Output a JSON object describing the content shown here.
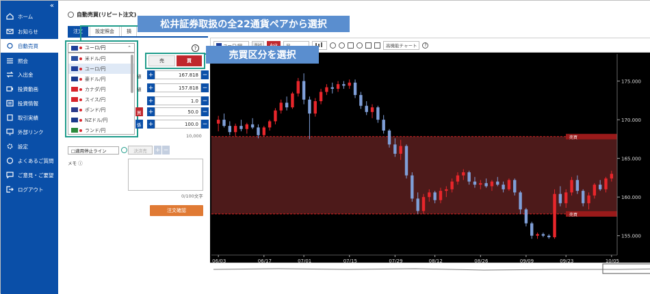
{
  "sidebar": {
    "collapse_icon": "«",
    "items": [
      {
        "label": "ホーム",
        "icon": "home-icon"
      },
      {
        "label": "お知らせ",
        "icon": "mail-icon"
      },
      {
        "label": "自動売買",
        "icon": "refresh-icon"
      },
      {
        "label": "照会",
        "icon": "list-icon"
      },
      {
        "label": "入出金",
        "icon": "transfer-icon"
      },
      {
        "label": "投資動画",
        "icon": "video-icon"
      },
      {
        "label": "投資情報",
        "icon": "news-icon"
      },
      {
        "label": "取引実績",
        "icon": "book-icon"
      },
      {
        "label": "外部リンク",
        "icon": "monitor-icon"
      },
      {
        "label": "設定",
        "icon": "gear-icon"
      },
      {
        "label": "よくあるご質問",
        "icon": "question-icon"
      },
      {
        "label": "ご意見・ご要望",
        "icon": "comment-icon"
      },
      {
        "label": "ログアウト",
        "icon": "logout-icon"
      }
    ]
  },
  "page": {
    "title": "自動売買(リピート注文)"
  },
  "tabs": [
    {
      "label": "注文"
    },
    {
      "label": "設定照会"
    },
    {
      "label": "損"
    }
  ],
  "form": {
    "selected_pair": "ユーロ/円",
    "pairs": [
      "米ドル/円",
      "ユーロ/円",
      "豪ドル/円",
      "カナダ/円",
      "スイス/円",
      "ポンド/円",
      "NZドル/円",
      "ランド/円"
    ],
    "sell_label": "売",
    "buy_label": "買",
    "help": "?",
    "upper_label": "値",
    "upper_value": "167.818",
    "lower_label": "値",
    "lower_value": "157.818",
    "step_value": "1.0",
    "range_tag": "買",
    "range_value": "50.0",
    "amount_tag": "係",
    "amount_value": "100.0",
    "amount_max": "10,000",
    "trail_label": "□適用停止ライン",
    "trail_value": "決済売",
    "memo_label": "メモ ⓘ",
    "memo_count": "0/100文字",
    "confirm_label": "注文確認"
  },
  "chart_toolbar": {
    "pair": "ユーロ/円",
    "bid": "Bid",
    "ask": "Ask",
    "timeframe": "日",
    "advanced": "高機能チャート",
    "help": "?"
  },
  "chart_data": {
    "type": "candlestick",
    "x_ticks": [
      "06/03",
      "06/17",
      "07/01",
      "07/15",
      "07/29",
      "08/12",
      "08/26",
      "09/09",
      "09/23",
      "10/05"
    ],
    "y_ticks": [
      175.0,
      170.0,
      165.0,
      160.0,
      155.0
    ],
    "y_tick_labels": [
      "175.000",
      "170.000",
      "165.000",
      "160.000",
      "155.000"
    ],
    "ylim": [
      152.5,
      178.5
    ],
    "range_band": [
      157.818,
      167.818
    ],
    "range_upper_tag": "売買",
    "range_lower_tag": "売買",
    "up_color": "#e8262b",
    "down_color": "#7f9fd8",
    "band_color": "#5a1f1f",
    "candles": [
      {
        "o": 169.5,
        "h": 170.5,
        "l": 168.5,
        "c": 170.0
      },
      {
        "o": 170.0,
        "h": 170.8,
        "l": 169.0,
        "c": 169.2
      },
      {
        "o": 169.2,
        "h": 169.8,
        "l": 168.0,
        "c": 168.4
      },
      {
        "o": 168.4,
        "h": 169.5,
        "l": 167.8,
        "c": 169.2
      },
      {
        "o": 169.2,
        "h": 170.0,
        "l": 168.5,
        "c": 168.8
      },
      {
        "o": 168.8,
        "h": 169.6,
        "l": 168.2,
        "c": 169.4
      },
      {
        "o": 169.4,
        "h": 170.2,
        "l": 168.8,
        "c": 169.0
      },
      {
        "o": 169.0,
        "h": 169.4,
        "l": 167.6,
        "c": 168.0
      },
      {
        "o": 168.0,
        "h": 169.2,
        "l": 167.8,
        "c": 169.0
      },
      {
        "o": 169.0,
        "h": 170.0,
        "l": 168.6,
        "c": 169.8
      },
      {
        "o": 169.8,
        "h": 171.5,
        "l": 169.4,
        "c": 171.2
      },
      {
        "o": 171.2,
        "h": 172.6,
        "l": 170.8,
        "c": 172.2
      },
      {
        "o": 172.2,
        "h": 173.0,
        "l": 171.2,
        "c": 171.6
      },
      {
        "o": 171.6,
        "h": 173.6,
        "l": 171.4,
        "c": 173.4
      },
      {
        "o": 173.4,
        "h": 175.4,
        "l": 173.0,
        "c": 175.0
      },
      {
        "o": 175.0,
        "h": 176.0,
        "l": 172.0,
        "c": 172.6
      },
      {
        "o": 172.6,
        "h": 173.0,
        "l": 167.5,
        "c": 170.8
      },
      {
        "o": 170.8,
        "h": 172.8,
        "l": 170.4,
        "c": 172.4
      },
      {
        "o": 172.4,
        "h": 174.0,
        "l": 172.0,
        "c": 173.6
      },
      {
        "o": 173.6,
        "h": 174.6,
        "l": 173.2,
        "c": 174.2
      },
      {
        "o": 174.2,
        "h": 174.8,
        "l": 173.4,
        "c": 174.0
      },
      {
        "o": 174.0,
        "h": 175.0,
        "l": 173.6,
        "c": 174.6
      },
      {
        "o": 174.6,
        "h": 175.0,
        "l": 174.0,
        "c": 174.4
      },
      {
        "o": 174.4,
        "h": 175.2,
        "l": 174.0,
        "c": 174.8
      },
      {
        "o": 174.8,
        "h": 175.2,
        "l": 172.8,
        "c": 173.2
      },
      {
        "o": 173.2,
        "h": 173.6,
        "l": 171.4,
        "c": 171.8
      },
      {
        "o": 171.8,
        "h": 172.4,
        "l": 170.6,
        "c": 171.0
      },
      {
        "o": 171.0,
        "h": 172.0,
        "l": 170.2,
        "c": 171.6
      },
      {
        "o": 171.6,
        "h": 171.8,
        "l": 169.6,
        "c": 170.0
      },
      {
        "o": 170.0,
        "h": 170.6,
        "l": 168.2,
        "c": 168.6
      },
      {
        "o": 168.6,
        "h": 168.8,
        "l": 166.4,
        "c": 166.8
      },
      {
        "o": 166.8,
        "h": 167.6,
        "l": 165.2,
        "c": 165.6
      },
      {
        "o": 165.6,
        "h": 167.4,
        "l": 164.8,
        "c": 166.6
      },
      {
        "o": 166.6,
        "h": 166.8,
        "l": 162.4,
        "c": 162.8
      },
      {
        "o": 162.8,
        "h": 163.2,
        "l": 159.4,
        "c": 159.8
      },
      {
        "o": 159.8,
        "h": 160.6,
        "l": 157.8,
        "c": 158.2
      },
      {
        "o": 158.2,
        "h": 160.4,
        "l": 157.8,
        "c": 160.0
      },
      {
        "o": 160.0,
        "h": 161.0,
        "l": 159.4,
        "c": 160.6
      },
      {
        "o": 160.6,
        "h": 160.8,
        "l": 159.2,
        "c": 159.6
      },
      {
        "o": 159.6,
        "h": 161.2,
        "l": 159.2,
        "c": 160.8
      },
      {
        "o": 160.8,
        "h": 161.4,
        "l": 160.0,
        "c": 161.0
      },
      {
        "o": 161.0,
        "h": 162.4,
        "l": 160.6,
        "c": 162.0
      },
      {
        "o": 162.0,
        "h": 163.2,
        "l": 161.6,
        "c": 162.8
      },
      {
        "o": 162.8,
        "h": 163.6,
        "l": 162.2,
        "c": 163.2
      },
      {
        "o": 163.2,
        "h": 163.4,
        "l": 161.6,
        "c": 162.0
      },
      {
        "o": 162.0,
        "h": 162.6,
        "l": 161.2,
        "c": 161.6
      },
      {
        "o": 161.6,
        "h": 162.2,
        "l": 161.0,
        "c": 161.8
      },
      {
        "o": 161.8,
        "h": 162.4,
        "l": 161.2,
        "c": 161.4
      },
      {
        "o": 161.4,
        "h": 162.2,
        "l": 160.8,
        "c": 162.0
      },
      {
        "o": 162.0,
        "h": 162.6,
        "l": 161.4,
        "c": 161.6
      },
      {
        "o": 161.6,
        "h": 162.0,
        "l": 160.6,
        "c": 161.0
      },
      {
        "o": 161.0,
        "h": 162.4,
        "l": 160.8,
        "c": 162.2
      },
      {
        "o": 162.2,
        "h": 162.4,
        "l": 160.2,
        "c": 160.6
      },
      {
        "o": 160.6,
        "h": 160.8,
        "l": 157.8,
        "c": 158.4
      },
      {
        "o": 158.4,
        "h": 158.6,
        "l": 156.2,
        "c": 156.6
      },
      {
        "o": 156.6,
        "h": 156.8,
        "l": 154.6,
        "c": 155.0
      },
      {
        "o": 155.0,
        "h": 155.4,
        "l": 154.6,
        "c": 155.2
      },
      {
        "o": 155.2,
        "h": 155.4,
        "l": 154.8,
        "c": 155.0
      },
      {
        "o": 155.0,
        "h": 155.2,
        "l": 154.6,
        "c": 154.8
      },
      {
        "o": 154.8,
        "h": 161.0,
        "l": 154.6,
        "c": 160.4
      },
      {
        "o": 160.4,
        "h": 161.4,
        "l": 158.8,
        "c": 159.2
      },
      {
        "o": 159.2,
        "h": 161.0,
        "l": 158.6,
        "c": 160.6
      },
      {
        "o": 160.6,
        "h": 162.6,
        "l": 160.2,
        "c": 162.2
      },
      {
        "o": 162.2,
        "h": 162.8,
        "l": 160.4,
        "c": 160.8
      },
      {
        "o": 160.8,
        "h": 161.0,
        "l": 158.8,
        "c": 159.2
      },
      {
        "o": 159.2,
        "h": 160.6,
        "l": 158.4,
        "c": 160.2
      },
      {
        "o": 160.2,
        "h": 161.8,
        "l": 159.8,
        "c": 161.6
      },
      {
        "o": 161.6,
        "h": 162.2,
        "l": 160.8,
        "c": 161.0
      },
      {
        "o": 161.0,
        "h": 162.6,
        "l": 160.6,
        "c": 162.4
      },
      {
        "o": 162.4,
        "h": 163.4,
        "l": 162.0,
        "c": 163.0
      }
    ]
  }
}
